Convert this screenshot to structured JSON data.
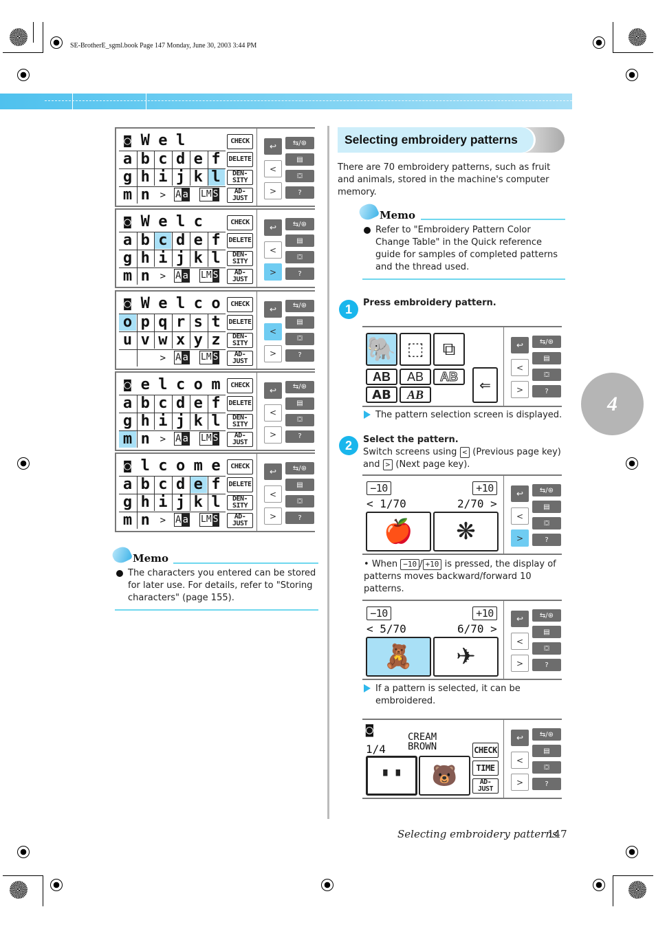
{
  "print_header": "SE-BrotherE_sgml.book  Page 147  Monday, June 30, 2003  3:44 PM",
  "colors": {
    "accent": "#19b6ec",
    "highlight": "#a9e0f6",
    "band": "#4fc1ee",
    "button_gray": "#6d6d6d"
  },
  "lcd_keys": {
    "check": "CHECK",
    "delete": "DELETE",
    "density": "DEN-\nSITY",
    "adjust": "AD-\nJUST",
    "time": "TIME",
    "case_a": "A",
    "case_b": "a",
    "size": "LM",
    "size_s": "S",
    "more": ">"
  },
  "panel_icons": {
    "back": "↩",
    "mode": "⇆/⊛",
    "page": "▤",
    "embroidery": "⛋",
    "help": "?"
  },
  "left_screens": [
    {
      "top": [
        "W",
        "e",
        "l",
        "",
        ""
      ],
      "rows": [
        [
          "a",
          "b",
          "c",
          "d",
          "e",
          "f"
        ],
        [
          "g",
          "h",
          "i",
          "j",
          "k",
          "l"
        ],
        [
          "m",
          "n"
        ]
      ],
      "highlight": [
        1,
        5
      ],
      "nav": "none"
    },
    {
      "top": [
        "W",
        "e",
        "l",
        "c",
        ""
      ],
      "rows": [
        [
          "a",
          "b",
          "c",
          "d",
          "e",
          "f"
        ],
        [
          "g",
          "h",
          "i",
          "j",
          "k",
          "l"
        ],
        [
          "m",
          "n"
        ]
      ],
      "highlight": [
        0,
        2
      ],
      "nav": "next"
    },
    {
      "top": [
        "W",
        "e",
        "l",
        "c",
        "o"
      ],
      "rows": [
        [
          "o",
          "p",
          "q",
          "r",
          "s",
          "t"
        ],
        [
          "u",
          "v",
          "w",
          "x",
          "y",
          "z"
        ],
        [
          "",
          ""
        ]
      ],
      "highlight": [
        0,
        0
      ],
      "nav": "prev"
    },
    {
      "top": [
        "e",
        "l",
        "c",
        "o",
        "m"
      ],
      "rows": [
        [
          "a",
          "b",
          "c",
          "d",
          "e",
          "f"
        ],
        [
          "g",
          "h",
          "i",
          "j",
          "k",
          "l"
        ],
        [
          "m",
          "n"
        ]
      ],
      "highlight": [
        2,
        0
      ],
      "nav": "none"
    },
    {
      "top": [
        "l",
        "c",
        "o",
        "m",
        "e"
      ],
      "rows": [
        [
          "a",
          "b",
          "c",
          "d",
          "e",
          "f"
        ],
        [
          "g",
          "h",
          "i",
          "j",
          "k",
          "l"
        ],
        [
          "m",
          "n"
        ]
      ],
      "highlight": [
        0,
        4
      ],
      "nav": "none"
    }
  ],
  "left_memo": {
    "title": "Memo",
    "text": "The characters you entered can be stored for later use. For details, refer to \"Storing characters\" (page 155)."
  },
  "section_title": "Selecting embroidery patterns",
  "intro": "There are 70 embroidery patterns, such as fruit and animals, stored in the machine's computer memory.",
  "right_memo": {
    "title": "Memo",
    "text": "Refer to \"Embroidery Pattern Color Change Table\" in the Quick reference guide for samples of completed patterns and the thread used."
  },
  "step1": {
    "num": "1",
    "title": "Press embroidery pattern.",
    "result": "The pattern selection screen is displayed."
  },
  "selection_screen": {
    "fonts": [
      "AB",
      "AB",
      "AB",
      "AB",
      "AB"
    ]
  },
  "step2": {
    "num": "2",
    "title": "Select the pattern.",
    "line1_a": "Switch screens using",
    "prev_key": "<",
    "line1_b": "(Previous page key)",
    "line2_a": "and",
    "next_key": ">",
    "line2_b": "(Next page key).",
    "note_a": "When",
    "minus_key": "−10",
    "slash": "/",
    "plus_key": "+10",
    "note_b": "is pressed, the display of patterns moves backward/forward 10 patterns.",
    "result": "If a pattern is selected, it can be embroidered."
  },
  "page_screens": [
    {
      "minus": "−10",
      "plus": "+10",
      "left": "< 1/70",
      "right": "2/70 >",
      "pats": [
        "🍎",
        "❋"
      ],
      "selected": -1,
      "nav": "next"
    },
    {
      "minus": "−10",
      "plus": "+10",
      "left": "< 5/70",
      "right": "6/70 >",
      "pats": [
        "🧸",
        "✈"
      ],
      "selected": 0,
      "nav": "none"
    }
  ],
  "final_screen": {
    "count": "1/4",
    "color_line1": "CREAM",
    "color_line2": "BROWN"
  },
  "chapter": "4",
  "footer": {
    "title": "Selecting embroidery patterns",
    "page": "147"
  }
}
